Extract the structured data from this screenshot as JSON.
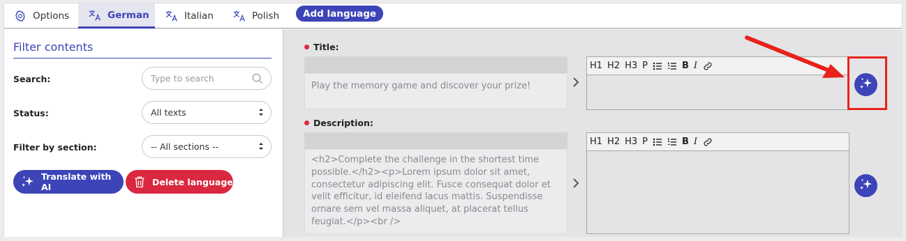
{
  "tabs": [
    {
      "label": "Options",
      "icon": "gear-icon"
    },
    {
      "label": "German",
      "icon": "translate-icon",
      "active": true
    },
    {
      "label": "Italian",
      "icon": "translate-icon"
    },
    {
      "label": "Polish",
      "icon": "translate-icon"
    }
  ],
  "add_language_label": "Add language",
  "filter": {
    "title": "Filter contents",
    "search_label": "Search:",
    "search_placeholder": "Type to search",
    "status_label": "Status:",
    "status_value": "All texts",
    "section_label": "Filter by section:",
    "section_value": "-- All sections --",
    "translate_ai_label": "Translate with AI",
    "delete_language_label": "Delete language"
  },
  "fields": [
    {
      "label": "Title:",
      "source_text": "Play the memory game and discover your prize!",
      "toolbar": [
        "H1",
        "H2",
        "H3",
        "P",
        "ul",
        "ol",
        "B",
        "I",
        "link"
      ]
    },
    {
      "label": "Description:",
      "source_text": "<h2>Complete the challenge in the shortest time possible.</h2><p>Lorem ipsum dolor sit amet, consectetur adipiscing elit. Fusce consequat dolor et velit efficitur, id eleifend lacus mattis. Suspendisse ornare sem vel massa aliquet, at placerat tellus feugiat.</p><br />",
      "toolbar": [
        "H1",
        "H2",
        "H3",
        "P",
        "ul",
        "ol",
        "B",
        "I",
        "link"
      ]
    }
  ],
  "toolbar_labels": {
    "h1": "H1",
    "h2": "H2",
    "h3": "H3",
    "p": "P",
    "b": "B",
    "i": "I"
  },
  "colors": {
    "accent": "#3c44b8",
    "danger": "#d9283f",
    "annotation": "#e8221b"
  }
}
